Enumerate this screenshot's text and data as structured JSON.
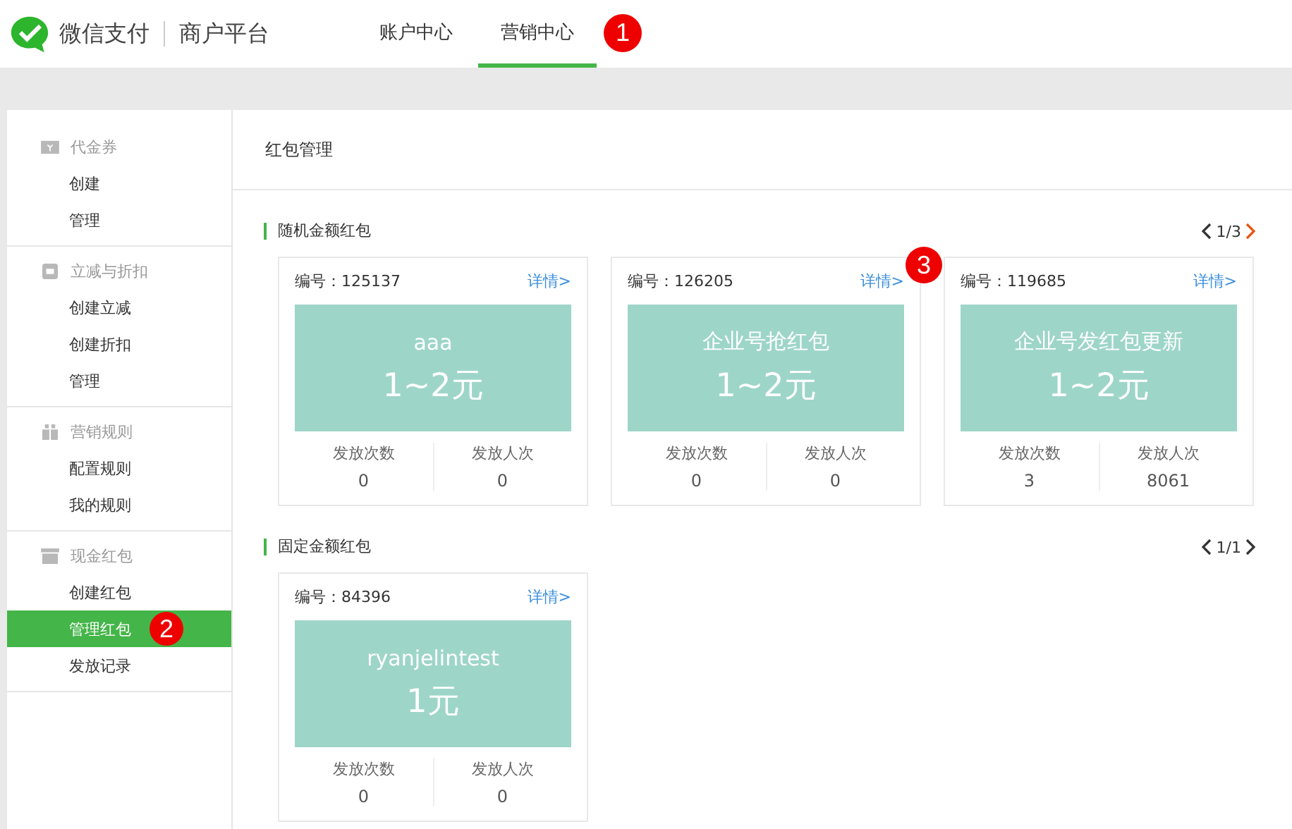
{
  "header": {
    "brand": "微信支付",
    "platform": "商户平台",
    "nav": [
      {
        "label": "账户中心",
        "selected": false
      },
      {
        "label": "营销中心",
        "selected": true
      }
    ]
  },
  "sidebar": {
    "groups": [
      {
        "title": "代金券",
        "items": [
          {
            "label": "创建",
            "selected": false
          },
          {
            "label": "管理",
            "selected": false
          }
        ]
      },
      {
        "title": "立减与折扣",
        "items": [
          {
            "label": "创建立减",
            "selected": false
          },
          {
            "label": "创建折扣",
            "selected": false
          },
          {
            "label": "管理",
            "selected": false
          }
        ]
      },
      {
        "title": "营销规则",
        "items": [
          {
            "label": "配置规则",
            "selected": false
          },
          {
            "label": "我的规则",
            "selected": false
          }
        ]
      },
      {
        "title": "现金红包",
        "items": [
          {
            "label": "创建红包",
            "selected": false
          },
          {
            "label": "管理红包",
            "selected": true
          },
          {
            "label": "发放记录",
            "selected": false
          }
        ]
      }
    ]
  },
  "page_title": "红包管理",
  "sections": [
    {
      "title": "随机金额红包",
      "pager": {
        "page": "1/3",
        "prev_enabled": false,
        "next_enabled": true
      },
      "cards": [
        {
          "id_label": "编号：125137",
          "detail": "详情>",
          "name": "aaa",
          "amount": "1~2元",
          "stats": [
            {
              "label": "发放次数",
              "value": "0"
            },
            {
              "label": "发放人次",
              "value": "0"
            }
          ]
        },
        {
          "id_label": "编号：126205",
          "detail": "详情>",
          "name": "企业号抢红包",
          "amount": "1~2元",
          "stats": [
            {
              "label": "发放次数",
              "value": "0"
            },
            {
              "label": "发放人次",
              "value": "0"
            }
          ]
        },
        {
          "id_label": "编号：119685",
          "detail": "详情>",
          "name": "企业号发红包更新",
          "amount": "1~2元",
          "stats": [
            {
              "label": "发放次数",
              "value": "3"
            },
            {
              "label": "发放人次",
              "value": "8061"
            }
          ]
        }
      ]
    },
    {
      "title": "固定金额红包",
      "pager": {
        "page": "1/1",
        "prev_enabled": false,
        "next_enabled": false
      },
      "cards": [
        {
          "id_label": "编号：84396",
          "detail": "详情>",
          "name": "ryanjelintest",
          "amount": "1元",
          "stats": [
            {
              "label": "发放次数",
              "value": "0"
            },
            {
              "label": "发放人次",
              "value": "0"
            }
          ]
        }
      ]
    }
  ],
  "callouts": [
    {
      "number": "1"
    },
    {
      "number": "2"
    },
    {
      "number": "3"
    }
  ]
}
